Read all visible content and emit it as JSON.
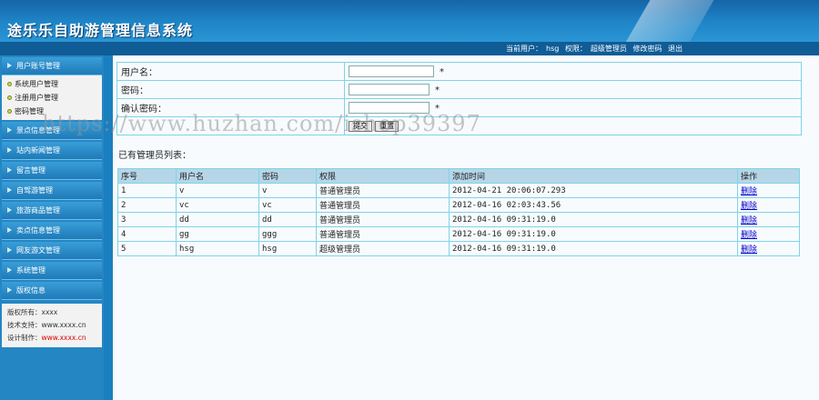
{
  "header": {
    "title": "途乐乐自助游管理信息系统",
    "current_user_label": "当前用户：",
    "current_user": "hsg",
    "role_label": "权限：",
    "role": "超级管理员",
    "change_password": "修改密码",
    "logout": "退出"
  },
  "sidebar": {
    "menus": [
      {
        "label": "用户账号管理",
        "items": [
          "系统用户管理",
          "注册用户管理",
          "密码管理"
        ]
      },
      {
        "label": "景点信息管理"
      },
      {
        "label": "站内新闻管理"
      },
      {
        "label": "留言管理"
      },
      {
        "label": "自驾游管理"
      },
      {
        "label": "旅游商品管理"
      },
      {
        "label": "卖点信息管理"
      },
      {
        "label": "网友游文管理"
      },
      {
        "label": "系统管理"
      },
      {
        "label": "版权信息"
      }
    ],
    "footer": {
      "copyright_label": "版权所有：",
      "copyright_value": "xxxx",
      "support_label": "技术支持：",
      "support_value": "www.xxxx.cn",
      "design_label": "设计制作：",
      "design_value": "www.xxxx.cn"
    }
  },
  "form": {
    "username_label": "用户名：",
    "password_label": "密码：",
    "confirm_label": "确认密码：",
    "username_value": "",
    "password_value": "",
    "confirm_value": "",
    "required_mark": "*",
    "submit_label": "提交",
    "reset_label": "重置"
  },
  "list": {
    "title": "已有管理员列表：",
    "columns": [
      "序号",
      "用户名",
      "密码",
      "权限",
      "添加时间",
      "操作"
    ],
    "rows": [
      {
        "id": "1",
        "username": "v",
        "password": "v",
        "role": "普通管理员",
        "added": "2012-04-21 20:06:07.293",
        "action": "删除"
      },
      {
        "id": "2",
        "username": "vc",
        "password": "vc",
        "role": "普通管理员",
        "added": "2012-04-16 02:03:43.56",
        "action": "删除"
      },
      {
        "id": "3",
        "username": "dd",
        "password": "dd",
        "role": "普通管理员",
        "added": "2012-04-16 09:31:19.0",
        "action": "删除"
      },
      {
        "id": "4",
        "username": "gg",
        "password": "ggg",
        "role": "普通管理员",
        "added": "2012-04-16 09:31:19.0",
        "action": "删除"
      },
      {
        "id": "5",
        "username": "hsg",
        "password": "hsg",
        "role": "超级管理员",
        "added": "2012-04-16 09:31:19.0",
        "action": "删除"
      }
    ]
  },
  "watermark": "https://www.huzhan.com/ishop39397"
}
